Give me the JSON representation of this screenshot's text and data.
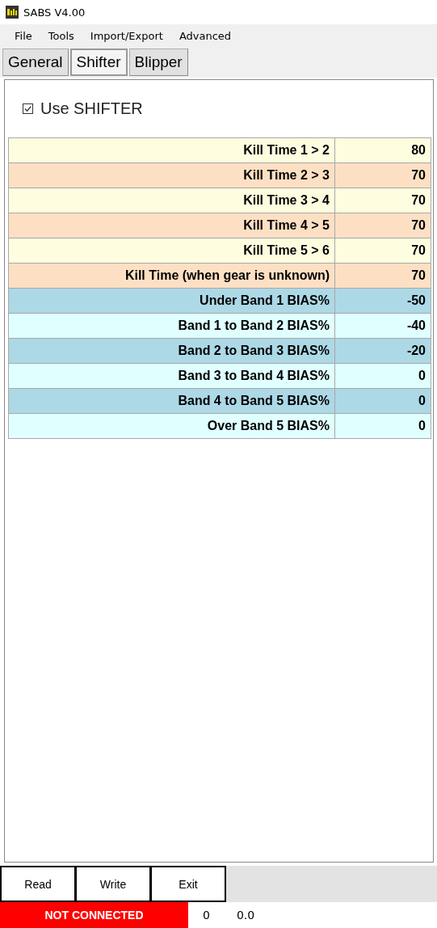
{
  "window": {
    "title": "SABS V4.00"
  },
  "menu": [
    "File",
    "Tools",
    "Import/Export",
    "Advanced"
  ],
  "tabs": [
    {
      "label": "General",
      "selected": false
    },
    {
      "label": "Shifter",
      "selected": true
    },
    {
      "label": "Blipper",
      "selected": false
    }
  ],
  "use_shifter": {
    "label": "Use SHIFTER",
    "checked": true
  },
  "table": {
    "rows": [
      {
        "label": "Kill Time 1 > 2",
        "value": "80",
        "color": "#fffde0"
      },
      {
        "label": "Kill Time 2 > 3",
        "value": "70",
        "color": "#fde0c4"
      },
      {
        "label": "Kill Time 3 > 4",
        "value": "70",
        "color": "#fffde0"
      },
      {
        "label": "Kill Time 4 > 5",
        "value": "70",
        "color": "#fde0c4"
      },
      {
        "label": "Kill Time 5 > 6",
        "value": "70",
        "color": "#fffde0"
      },
      {
        "label": "Kill Time (when gear is unknown)",
        "value": "70",
        "color": "#fde0c4"
      },
      {
        "label": "Under Band 1 BIAS%",
        "value": "-50",
        "color": "#add8e6"
      },
      {
        "label": "Band 1 to Band 2 BIAS%",
        "value": "-40",
        "color": "#e0ffff"
      },
      {
        "label": "Band 2 to Band 3 BIAS%",
        "value": "-20",
        "color": "#add8e6"
      },
      {
        "label": "Band 3 to Band 4 BIAS%",
        "value": "0",
        "color": "#e0ffff"
      },
      {
        "label": "Band 4 to Band 5 BIAS%",
        "value": "0",
        "color": "#add8e6"
      },
      {
        "label": "Over Band 5 BIAS%",
        "value": "0",
        "color": "#e0ffff"
      }
    ]
  },
  "buttons": [
    "Read",
    "Write",
    "Exit"
  ],
  "status_bar": {
    "connection": "NOT CONNECTED",
    "value_1": "0",
    "value_2": "0.0"
  }
}
